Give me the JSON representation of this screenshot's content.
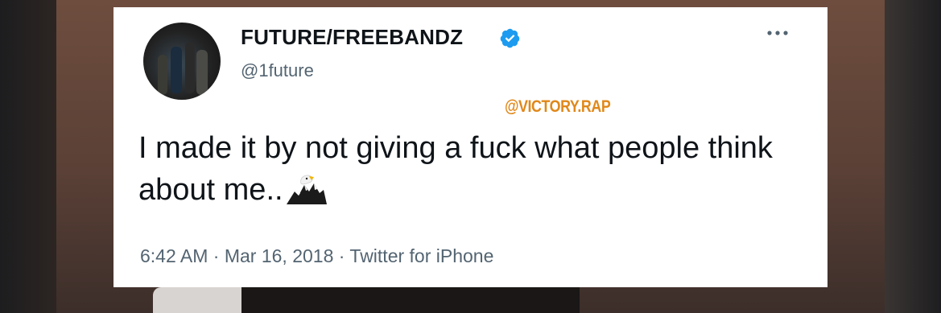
{
  "tweet": {
    "display_name": "FUTURE/FREEBANDZ",
    "handle": "@1future",
    "watermark": "@VICTORY.RAP",
    "text": "I made it by not giving a fuck what people think about me..",
    "emoji_icon": "eagle-icon",
    "time": "6:42 AM",
    "separator": "·",
    "date": "Mar 16, 2018",
    "source": "Twitter for iPhone",
    "verified": true,
    "more_icon": "more-options-icon",
    "colors": {
      "verified_blue": "#1d9bf0",
      "text": "#0f1419",
      "secondary": "#536471",
      "watermark": "#e0881a"
    }
  }
}
